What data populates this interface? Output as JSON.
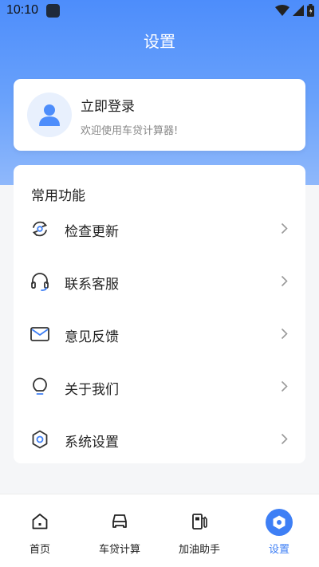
{
  "status_bar": {
    "time": "10:10"
  },
  "header": {
    "title": "设置"
  },
  "login": {
    "title": "立即登录",
    "subtitle": "欢迎使用车贷计算器!"
  },
  "functions": {
    "title": "常用功能",
    "items": [
      {
        "label": "检查更新",
        "icon": "refresh-icon"
      },
      {
        "label": "联系客服",
        "icon": "headset-icon"
      },
      {
        "label": "意见反馈",
        "icon": "mail-icon"
      },
      {
        "label": "关于我们",
        "icon": "lightbulb-icon"
      },
      {
        "label": "系统设置",
        "icon": "gear-icon"
      }
    ]
  },
  "tabbar": {
    "items": [
      {
        "label": "首页",
        "icon": "home-icon"
      },
      {
        "label": "车贷计算",
        "icon": "car-icon"
      },
      {
        "label": "加油助手",
        "icon": "fuel-pump-icon"
      },
      {
        "label": "设置",
        "icon": "settings-icon"
      }
    ],
    "active_index": 3
  },
  "colors": {
    "accent": "#3e7ff5",
    "header_gradient_top": "#4d8dfb",
    "header_gradient_bottom": "#8fb8fb",
    "background": "#f5f6f8"
  }
}
